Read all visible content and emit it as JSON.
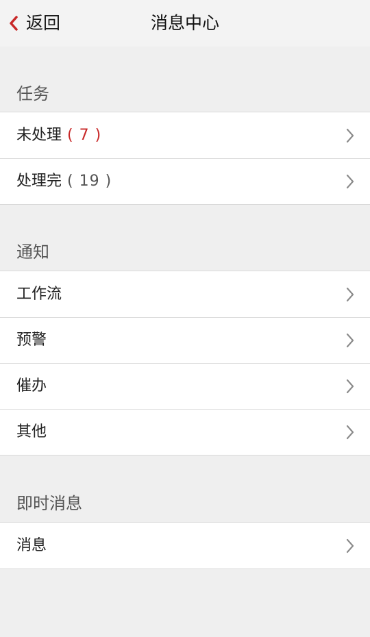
{
  "nav": {
    "back_label": "返回",
    "title": "消息中心",
    "accent_color": "#c82828"
  },
  "sections": {
    "tasks": {
      "header": "任务",
      "items": [
        {
          "label": "未处理",
          "count": "( 7 )",
          "count_color": "#c82828"
        },
        {
          "label": "处理完",
          "count": "( 19 )",
          "count_color": "#555555"
        }
      ]
    },
    "notifications": {
      "header": "通知",
      "items": [
        {
          "label": "工作流"
        },
        {
          "label": "预警"
        },
        {
          "label": "催办"
        },
        {
          "label": "其他"
        }
      ]
    },
    "instant": {
      "header": "即时消息",
      "items": [
        {
          "label": "消息"
        }
      ]
    }
  },
  "icons": {
    "back": "chevron-left-icon",
    "row": "chevron-right-icon"
  }
}
